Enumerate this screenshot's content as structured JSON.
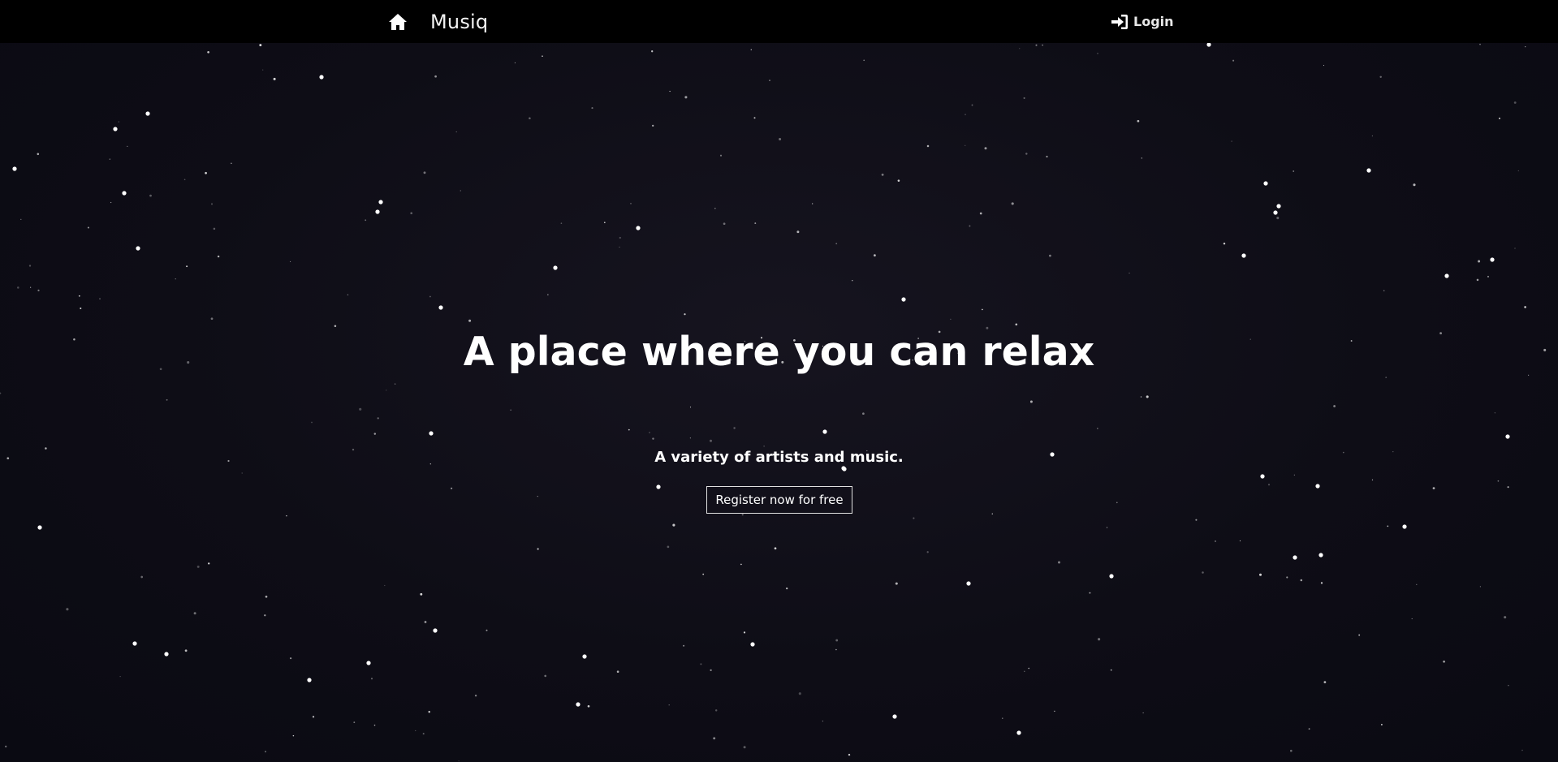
{
  "navbar": {
    "home_icon": "home-icon",
    "brand": "Musiq",
    "login_icon": "sign-in-icon",
    "login_label": "Login"
  },
  "hero": {
    "title": "A place where you can relax",
    "subtitle": "A variety of artists and music.",
    "register_label": "Register now for free"
  },
  "colors": {
    "navbar_bg": "#000000",
    "hero_bg": "#0e0d16",
    "text": "#ffffff"
  }
}
